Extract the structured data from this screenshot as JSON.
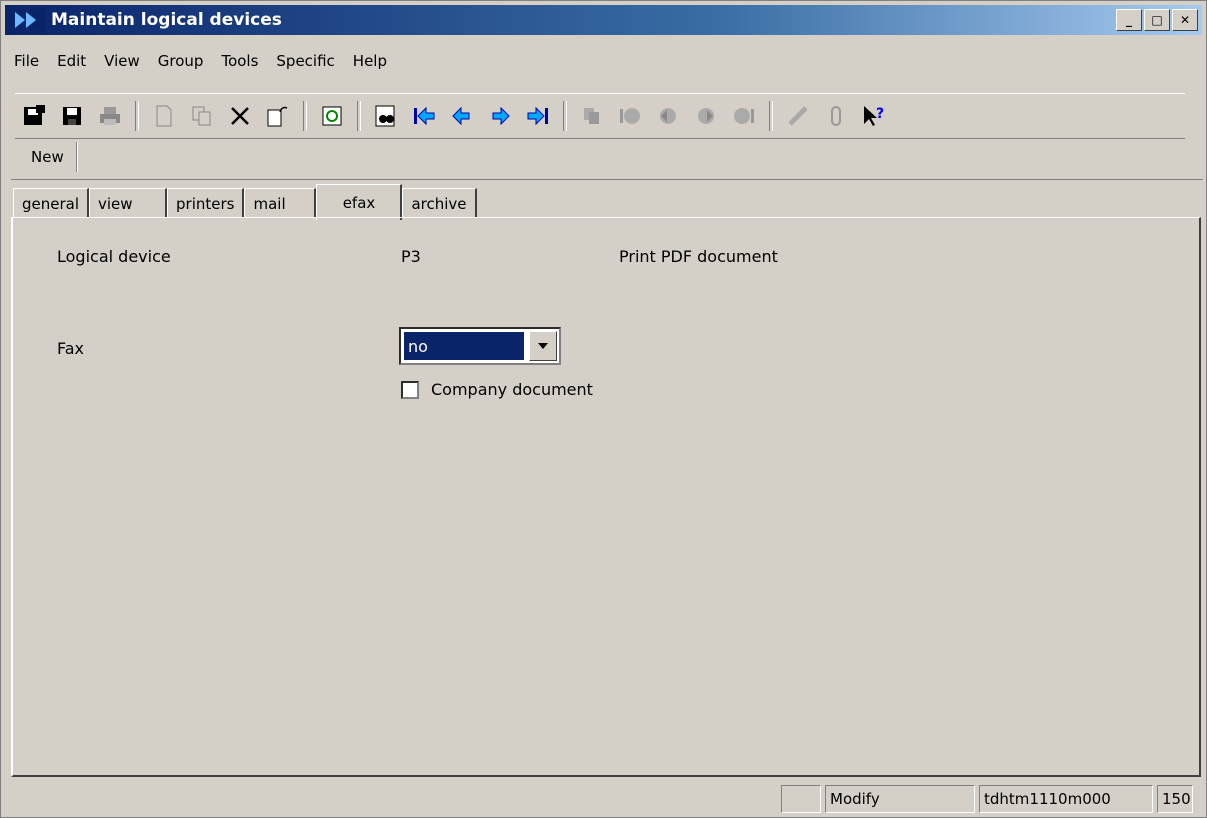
{
  "window": {
    "title": "Maintain logical devices"
  },
  "menu": [
    "File",
    "Edit",
    "View",
    "Group",
    "Tools",
    "Specific",
    "Help"
  ],
  "toolbar": {
    "icons": [
      "save-close-icon",
      "save-icon",
      "print-icon",
      "new-document-icon",
      "duplicate-icon",
      "delete-icon",
      "properties-icon",
      "refresh-icon",
      "find-icon",
      "first-record-icon",
      "previous-record-icon",
      "next-record-icon",
      "last-record-icon",
      "group-duplicate-icon",
      "first-group-icon",
      "previous-group-icon",
      "next-group-icon",
      "last-group-icon",
      "text-icon",
      "attachment-icon",
      "help-pointer-icon"
    ]
  },
  "new_button": "New",
  "tabs": [
    "general",
    "view",
    "printers",
    "mail",
    "efax",
    "archive"
  ],
  "active_tab": "efax",
  "form": {
    "logical_device_label": "Logical device",
    "logical_device_value": "P3",
    "logical_device_desc": "Print PDF document",
    "fax_label": "Fax",
    "fax_value": "no",
    "company_document_label": "Company document",
    "company_document_checked": false
  },
  "status": {
    "cell1": "",
    "mode": "Modify",
    "session": "tdhtm1110m000",
    "number": "150"
  }
}
